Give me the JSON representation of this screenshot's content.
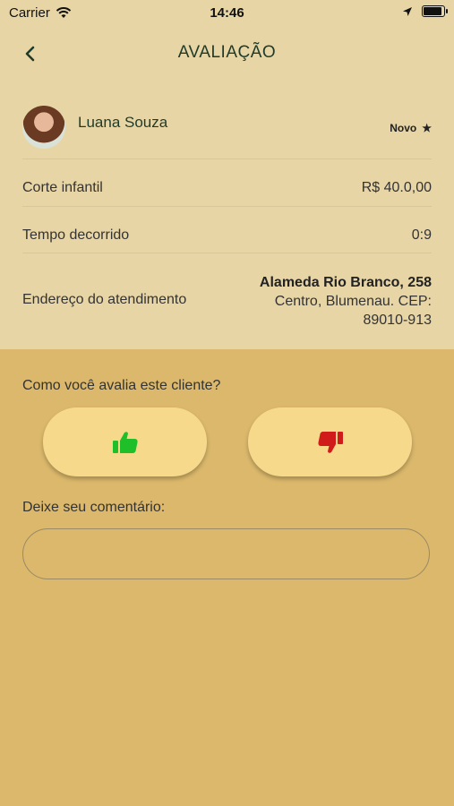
{
  "status_bar": {
    "carrier": "Carrier",
    "time": "14:46"
  },
  "header": {
    "title": "AVALIAÇÃO"
  },
  "client": {
    "name": "Luana Souza",
    "badge": "Novo"
  },
  "details": {
    "service_label": "Corte infantil",
    "service_price": "R$ 40.0,00",
    "elapsed_label": "Tempo decorrido",
    "elapsed_value": "0:9",
    "address_label": "Endereço do atendimento",
    "address_street": "Alameda Rio Branco, 258",
    "address_line2": "Centro, Blumenau. CEP:",
    "address_line3": "89010-913"
  },
  "rating": {
    "question": "Como você avalia este cliente?",
    "thumbs_up_color": "#1fbf2a",
    "thumbs_down_color": "#d11a1a"
  },
  "comment": {
    "label": "Deixe seu comentário:",
    "value": ""
  },
  "colors": {
    "top_bg": "#e8d5a6",
    "bottom_bg": "#dbb86b",
    "button_bg": "#f7d98b"
  }
}
